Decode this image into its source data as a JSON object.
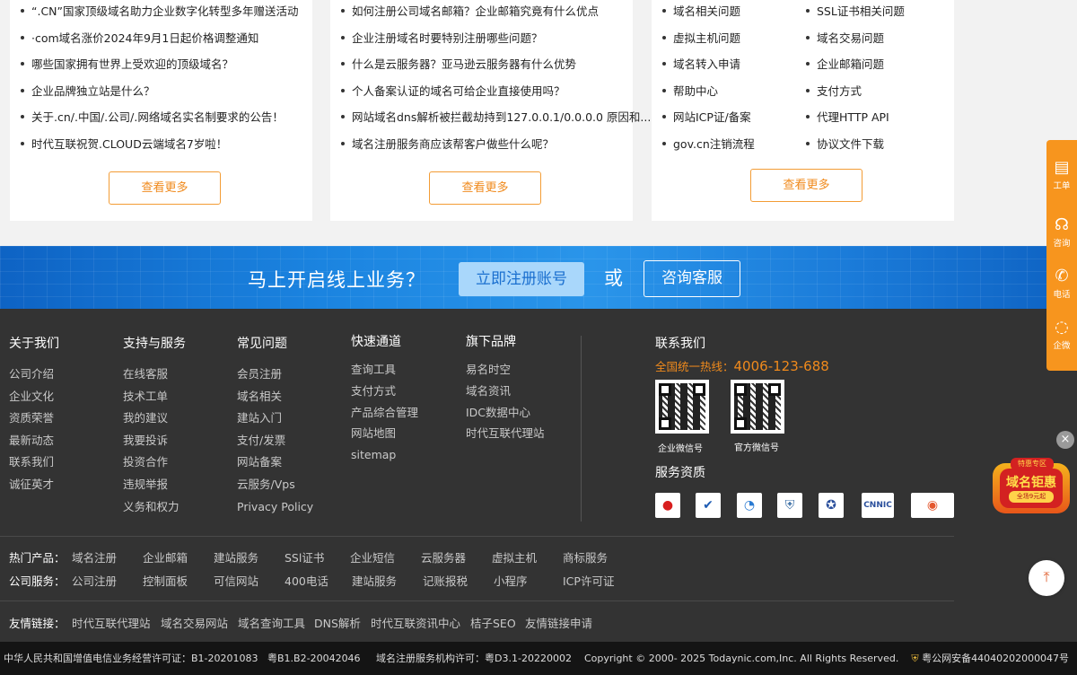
{
  "cards": [
    {
      "items": [
        "“.CN”国家顶级域名助力企业数字化转型多年赠送活动",
        "·com域名涨价2024年9月1日起价格调整通知",
        "哪些国家拥有世界上受欢迎的顶级域名？",
        "企业品牌独立站是什么？",
        "关于.cn/.中国/.公司/.网络域名实名制要求的公告！",
        "时代互联祝贺.CLOUD云端域名7岁啦！"
      ],
      "more": "查看更多"
    },
    {
      "items": [
        "如何注册公司域名邮箱？企业邮箱究竟有什么优点",
        "企业注册域名时要特别注册哪些问题？",
        "什么是云服务器？亚马逊云服务器有什么优势",
        "个人备案认证的域名可给企业直接使用吗？",
        "网站域名dns解析被拦截劫持到127.0.0.1/0.0.0.0 原因和...",
        "域名注册服务商应该帮客户做些什么呢？"
      ],
      "more": "查看更多"
    },
    {
      "left": [
        "域名相关问题",
        "虚拟主机问题",
        "域名转入申请",
        "帮助中心",
        "网站ICP证/备案",
        "gov.cn注销流程"
      ],
      "right": [
        "SSL证书相关问题",
        "域名交易问题",
        "企业邮箱问题",
        "支付方式",
        "代理HTTP API",
        "协议文件下载"
      ],
      "more": "查看更多"
    }
  ],
  "banner": {
    "text": "马上开启线上业务？",
    "register": "立即注册账号",
    "or": "或",
    "consult": "咨询客服"
  },
  "footer_cols": [
    {
      "title": "关于我们",
      "links": [
        "公司介绍",
        "企业文化",
        "资质荣誉",
        "最新动态",
        "联系我们",
        "诚征英才"
      ]
    },
    {
      "title": "支持与服务",
      "links": [
        "在线客服",
        "技术工单",
        "我的建议",
        "我要投诉",
        "投资合作",
        "违规举报",
        "义务和权力"
      ]
    },
    {
      "title": "常见问题",
      "links": [
        "会员注册",
        "域名相关",
        "建站入门",
        "支付/发票",
        "网站备案",
        "云服务/Vps",
        "Privacy Policy"
      ]
    },
    {
      "title": "快速通道",
      "links": [
        "查询工具",
        "支付方式",
        "产品综合管理",
        "网站地图",
        "sitemap"
      ]
    },
    {
      "title": "旗下品牌",
      "links": [
        "易名时空",
        "域名资讯",
        "IDC数据中心",
        "时代互联代理站"
      ]
    }
  ],
  "contact": {
    "title": "联系我们",
    "hotline_label": "全国统一热线：",
    "hotline": "4006-123-688",
    "qr1": "企业微信号",
    "qr2": "官方微信号",
    "qualifications": "服务资质"
  },
  "hot_products": {
    "label": "热门产品：",
    "items": [
      "域名注册",
      "企业邮箱",
      "建站服务",
      "SSl证书",
      "企业短信",
      "云服务器",
      "虚拟主机",
      "商标服务"
    ]
  },
  "company_services": {
    "label": "公司服务：",
    "items": [
      "公司注册",
      "控制面板",
      "可信网站",
      "400电话",
      "建站服务",
      "记账报税",
      "小程序",
      "ICP许可证"
    ]
  },
  "friend_links": {
    "label": "友情链接：",
    "items": [
      "时代互联代理站",
      "域名交易网站",
      "域名查询工具",
      "DNS解析",
      "时代互联资讯中心",
      "桔子SEO",
      "友情链接申请"
    ]
  },
  "bottom": {
    "icp": "中华人民共和国增值电信业务经营许可证：B1-20201083",
    "yue": "粤B1.B2-20042046",
    "domain_license": "域名注册服务机构许可：粤D3.1-20220002",
    "copyright": "Copyright © 2000- 2025 Todaynic.com,Inc. All Rights Reserved.",
    "police": "粤公网安备44040202000047号"
  },
  "sidebar": [
    {
      "icon": "ticket-icon",
      "label": "工单"
    },
    {
      "icon": "headset-icon",
      "label": "咨询"
    },
    {
      "icon": "phone-icon",
      "label": "电话"
    },
    {
      "icon": "chat-icon",
      "label": "企微"
    }
  ],
  "promo": {
    "line1": "特惠专区",
    "line2": "域名钜惠",
    "line3": "全场9元起"
  },
  "colors": {
    "accent": "#f7951e",
    "banner": "#1b84e0",
    "footer": "#333333",
    "bottom": "#141414"
  }
}
